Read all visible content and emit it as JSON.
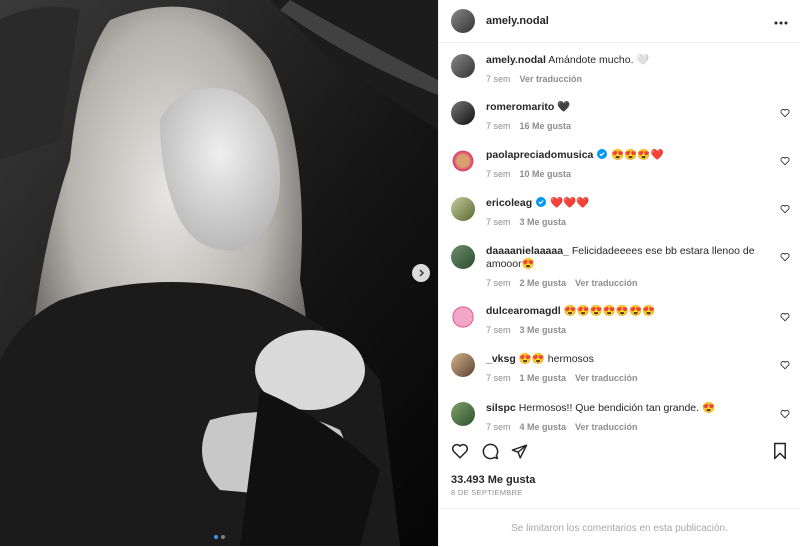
{
  "post": {
    "username": "amely.nodal",
    "likes": "33.493 Me gusta",
    "date": "8 DE SEPTIEMBRE",
    "footer": "Se limitaron los comentarios en esta publicación.",
    "caption": {
      "user": "amely.nodal",
      "text": "Amándote mucho. 🤍",
      "time": "7 sem",
      "translate": "Ver traducción"
    }
  },
  "comments": [
    {
      "user": "romeromarito",
      "text": "🖤",
      "time": "7 sem",
      "likes": "16 Me gusta",
      "verified": false,
      "translate": ""
    },
    {
      "user": "paolapreciadomusica",
      "text": "😍😍😍❤️",
      "time": "7 sem",
      "likes": "10 Me gusta",
      "verified": true,
      "translate": ""
    },
    {
      "user": "ericoleag",
      "text": "❤️❤️❤️",
      "time": "7 sem",
      "likes": "3 Me gusta",
      "verified": true,
      "translate": ""
    },
    {
      "user": "daaaanielaaaaa_",
      "text": "Felicidadeeees ese bb estara llenoo de amooor😍",
      "time": "7 sem",
      "likes": "2 Me gusta",
      "verified": false,
      "translate": "Ver traducción"
    },
    {
      "user": "dulcearomagdl",
      "text": "😍😍😍😍😍😍😍",
      "time": "7 sem",
      "likes": "3 Me gusta",
      "verified": false,
      "translate": ""
    },
    {
      "user": "_vksg",
      "text": "😍😍 hermosos",
      "time": "7 sem",
      "likes": "1 Me gusta",
      "verified": false,
      "translate": "Ver traducción"
    },
    {
      "user": "silspc",
      "text": "Hermosos!! Que bendición tan grande. 😍",
      "time": "7 sem",
      "likes": "4 Me gusta",
      "verified": false,
      "translate": "Ver traducción"
    }
  ],
  "icons": {
    "more": "more-icon",
    "next": "chevron-right-icon",
    "like": "heart-icon",
    "comment": "comment-icon",
    "share": "share-icon",
    "save": "bookmark-icon"
  },
  "colors": {
    "verified": "#0095f6",
    "active_dot": "#3897f0",
    "muted": "#8e8e8e"
  }
}
